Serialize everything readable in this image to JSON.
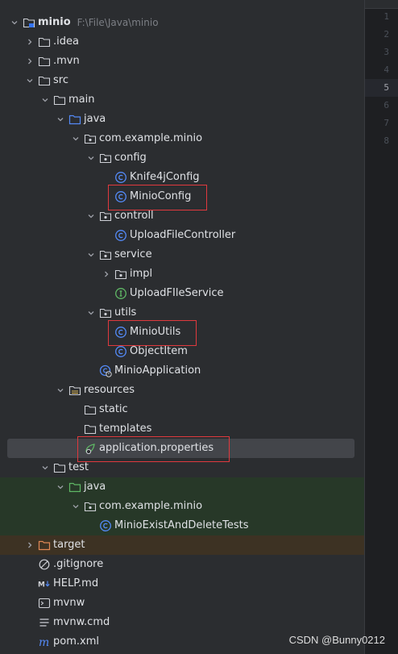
{
  "tree": [
    {
      "label": "minio",
      "hint": "F:\\File\\Java\\minio",
      "depth": 0,
      "chev": "down",
      "icon": "module-folder",
      "bold": true
    },
    {
      "label": ".idea",
      "depth": 1,
      "chev": "right",
      "icon": "folder"
    },
    {
      "label": ".mvn",
      "depth": 1,
      "chev": "right",
      "icon": "folder"
    },
    {
      "label": "src",
      "depth": 1,
      "chev": "down",
      "icon": "folder"
    },
    {
      "label": "main",
      "depth": 2,
      "chev": "down",
      "icon": "folder"
    },
    {
      "label": "java",
      "depth": 3,
      "chev": "down",
      "icon": "source-folder"
    },
    {
      "label": "com.example.minio",
      "depth": 4,
      "chev": "down",
      "icon": "package"
    },
    {
      "label": "config",
      "depth": 5,
      "chev": "down",
      "icon": "package"
    },
    {
      "label": "Knife4jConfig",
      "depth": 6,
      "chev": "none",
      "icon": "class"
    },
    {
      "label": "MinioConfig",
      "depth": 6,
      "chev": "none",
      "icon": "class",
      "highlight": true
    },
    {
      "label": "controll",
      "depth": 5,
      "chev": "down",
      "icon": "package"
    },
    {
      "label": "UploadFileController",
      "depth": 6,
      "chev": "none",
      "icon": "class"
    },
    {
      "label": "service",
      "depth": 5,
      "chev": "down",
      "icon": "package"
    },
    {
      "label": "impl",
      "depth": 6,
      "chev": "right",
      "icon": "package"
    },
    {
      "label": "UploadFIleService",
      "depth": 6,
      "chev": "none",
      "icon": "interface"
    },
    {
      "label": "utils",
      "depth": 5,
      "chev": "down",
      "icon": "package"
    },
    {
      "label": "MinioUtils",
      "depth": 6,
      "chev": "none",
      "icon": "class",
      "highlight": true
    },
    {
      "label": "ObjectItem",
      "depth": 6,
      "chev": "none",
      "icon": "class"
    },
    {
      "label": "MinioApplication",
      "depth": 5,
      "chev": "none",
      "icon": "spring-app"
    },
    {
      "label": "resources",
      "depth": 3,
      "chev": "down",
      "icon": "resources-folder"
    },
    {
      "label": "static",
      "depth": 4,
      "chev": "none",
      "icon": "folder"
    },
    {
      "label": "templates",
      "depth": 4,
      "chev": "none",
      "icon": "folder"
    },
    {
      "label": "application.properties",
      "depth": 4,
      "chev": "none",
      "icon": "properties",
      "selected": true,
      "highlight": true
    },
    {
      "label": "test",
      "depth": 2,
      "chev": "down",
      "icon": "folder"
    },
    {
      "label": "java",
      "depth": 3,
      "chev": "down",
      "icon": "test-folder",
      "bg": "test"
    },
    {
      "label": "com.example.minio",
      "depth": 4,
      "chev": "down",
      "icon": "package",
      "bg": "test"
    },
    {
      "label": "MinioExistAndDeleteTests",
      "depth": 5,
      "chev": "none",
      "icon": "test-class",
      "bg": "test"
    },
    {
      "label": "target",
      "depth": 1,
      "chev": "right",
      "icon": "excluded-folder",
      "bg": "target"
    },
    {
      "label": ".gitignore",
      "depth": 1,
      "chev": "none",
      "icon": "ignore"
    },
    {
      "label": "HELP.md",
      "depth": 1,
      "chev": "none",
      "icon": "markdown"
    },
    {
      "label": "mvnw",
      "depth": 1,
      "chev": "none",
      "icon": "shell"
    },
    {
      "label": "mvnw.cmd",
      "depth": 1,
      "chev": "none",
      "icon": "text"
    },
    {
      "label": "pom.xml",
      "depth": 1,
      "chev": "none",
      "icon": "maven"
    }
  ],
  "line_numbers": [
    "1",
    "2",
    "3",
    "4",
    "5",
    "6",
    "7",
    "8"
  ],
  "current_line": "5",
  "watermark": "CSDN @Bunny0212"
}
